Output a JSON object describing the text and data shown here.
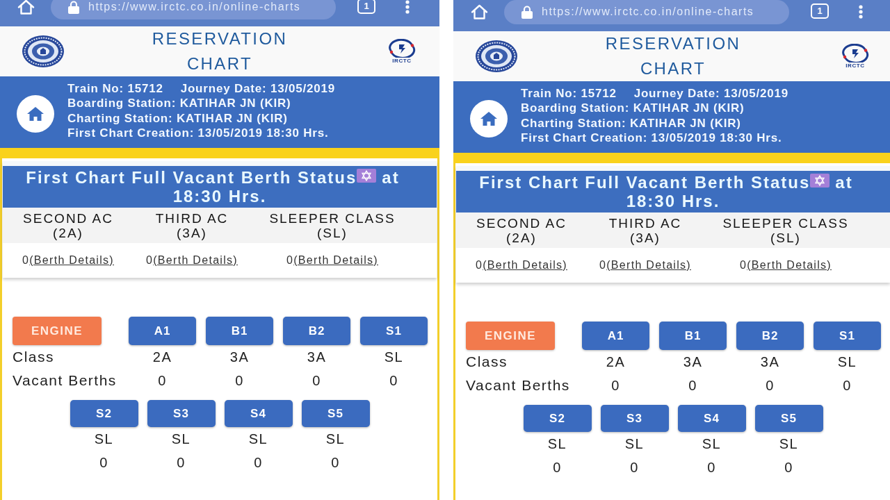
{
  "screenshots": [
    {
      "browser_bar": {
        "url": "https://www.irctc.co.in/online-charts",
        "tab_count": "1"
      },
      "header": {
        "title": "RESERVATION CHART",
        "logo_caption": "IRCTC"
      },
      "train_info": {
        "train_no": "Train No: 15712",
        "journey_date": "Journey Date: 13/05/2019",
        "boarding_station": "Boarding Station: KATIHAR JN (KIR)",
        "charting_station": "Charting Station: KATIHAR JN (KIR)",
        "first_chart_creation": "First Chart Creation: 13/05/2019 18:30 Hrs."
      },
      "vacant_berth_status": {
        "title": "First Chart Full Vacant Berth Status",
        "title_end": "at",
        "title_line_2": "18:30 Hrs.",
        "classes": [
          {
            "name": "SECOND AC",
            "code": "(2A)",
            "vacant": "0",
            "link": "(Berth Details)"
          },
          {
            "name": "THIRD AC",
            "code": "(3A)",
            "vacant": "0",
            "link": "(Berth Details)"
          },
          {
            "name": "SLEEPER CLASS",
            "code": "(SL)",
            "vacant": "0",
            "link": "(Berth Details)"
          }
        ]
      },
      "coach_layout": {
        "engine": "ENGINE",
        "class_label": "Class",
        "vacant_berths_label": "Vacant Berths",
        "coach_rows": [
          [
            {
              "coach": "A1",
              "class": "2A",
              "vacant_berths": "0"
            },
            {
              "coach": "B1",
              "class": "3A",
              "vacant_berths": "0"
            },
            {
              "coach": "B2",
              "class": "3A",
              "vacant_berths": "0"
            },
            {
              "coach": "S1",
              "class": "SL",
              "vacant_berths": "0"
            }
          ],
          [
            {
              "coach": "S2",
              "class": "SL",
              "vacant_berths": "0"
            },
            {
              "coach": "S3",
              "class": "SL",
              "vacant_berths": "0"
            },
            {
              "coach": "S4",
              "class": "SL",
              "vacant_berths": "0"
            },
            {
              "coach": "S5",
              "class": "SL",
              "vacant_berths": "0"
            }
          ]
        ]
      }
    },
    {
      "browser_bar": {
        "url": "https://www.irctc.co.in/online-charts",
        "tab_count": "1"
      },
      "header": {
        "title": "RESERVATION CHART",
        "logo_caption": "IRCTC"
      },
      "train_info": {
        "train_no": "Train No: 15712",
        "journey_date": "Journey Date: 13/05/2019",
        "boarding_station": "Boarding Station: KATIHAR JN (KIR)",
        "charting_station": "Charting Station: KATIHAR JN (KIR)",
        "first_chart_creation": "First Chart Creation: 13/05/2019 18:30 Hrs."
      },
      "vacant_berth_status": {
        "title": "First Chart Full Vacant Berth Status",
        "title_end": "at",
        "title_line_2": "18:30 Hrs.",
        "classes": [
          {
            "name": "SECOND AC",
            "code": "(2A)",
            "vacant": "0",
            "link": "(Berth Details)"
          },
          {
            "name": "THIRD AC",
            "code": "(3A)",
            "vacant": "0",
            "link": "(Berth Details)"
          },
          {
            "name": "SLEEPER CLASS",
            "code": "(SL)",
            "vacant": "0",
            "link": "(Berth Details)"
          }
        ]
      },
      "coach_layout": {
        "engine": "ENGINE",
        "class_label": "Class",
        "vacant_berths_label": "Vacant Berths",
        "coach_rows": [
          [
            {
              "coach": "A1",
              "class": "2A",
              "vacant_berths": "0"
            },
            {
              "coach": "B1",
              "class": "3A",
              "vacant_berths": "0"
            },
            {
              "coach": "B2",
              "class": "3A",
              "vacant_berths": "0"
            },
            {
              "coach": "S1",
              "class": "SL",
              "vacant_berths": "0"
            }
          ],
          [
            {
              "coach": "S2",
              "class": "SL",
              "vacant_berths": "0"
            },
            {
              "coach": "S3",
              "class": "SL",
              "vacant_berths": "0"
            },
            {
              "coach": "S4",
              "class": "SL",
              "vacant_berths": "0"
            },
            {
              "coach": "S5",
              "class": "SL",
              "vacant_berths": "0"
            }
          ]
        ]
      }
    }
  ]
}
